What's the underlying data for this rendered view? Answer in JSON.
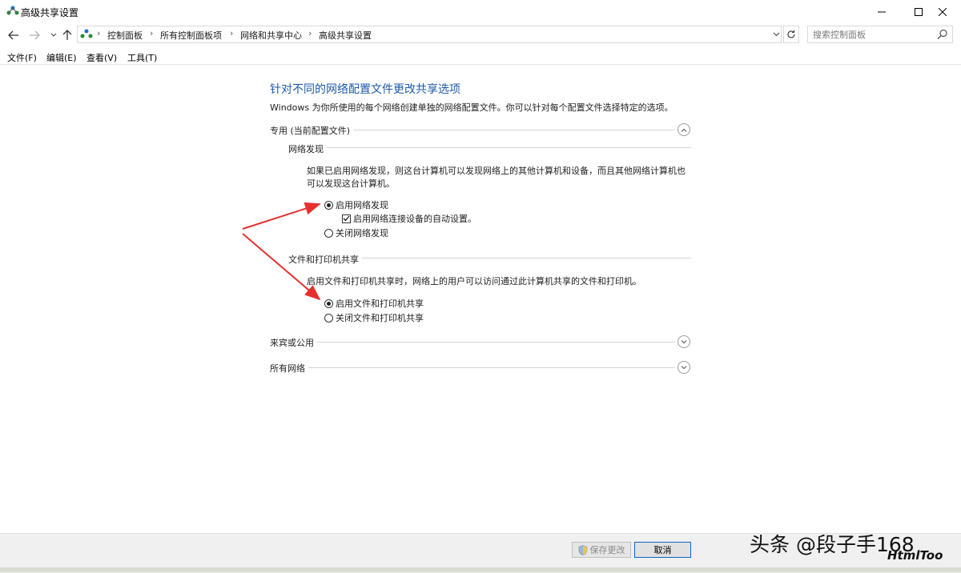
{
  "window": {
    "title": "高级共享设置",
    "minimize": "—",
    "maximize": "☐",
    "close": "✕"
  },
  "nav": {
    "back": "←",
    "forward": "→",
    "recent": "⌄",
    "up": "↑",
    "breadcrumbs": [
      "控制面板",
      "所有控制面板项",
      "网络和共享中心",
      "高级共享设置"
    ],
    "separator": "›",
    "search_placeholder": "搜索控制面板"
  },
  "menu": [
    "文件(F)",
    "编辑(E)",
    "查看(V)",
    "工具(T)"
  ],
  "content": {
    "title": "针对不同的网络配置文件更改共享选项",
    "subtitle": "Windows 为你所使用的每个网络创建单独的网络配置文件。你可以针对每个配置文件选择特定的选项。",
    "private": {
      "header": "专用 (当前配置文件)",
      "discovery": {
        "header": "网络发现",
        "desc": "如果已启用网络发现，则这台计算机可以发现网络上的其他计算机和设备，而且其他网络计算机也可以发现这台计算机。",
        "option_on": "启用网络发现",
        "auto_setup": "启用网络连接设备的自动设置。",
        "option_off": "关闭网络发现"
      },
      "sharing": {
        "header": "文件和打印机共享",
        "desc": "启用文件和打印机共享时，网络上的用户可以访问通过此计算机共享的文件和打印机。",
        "option_on": "启用文件和打印机共享",
        "option_off": "关闭文件和打印机共享"
      }
    },
    "guest": {
      "header": "来宾或公用"
    },
    "all": {
      "header": "所有网络"
    }
  },
  "footer": {
    "save": "保存更改",
    "cancel": "取消",
    "watermark": "头条 @段子手168",
    "watermark_logo": "HtmlToo"
  },
  "colors": {
    "title_blue": "#1e5aa8",
    "arrow_red": "#e53030"
  }
}
